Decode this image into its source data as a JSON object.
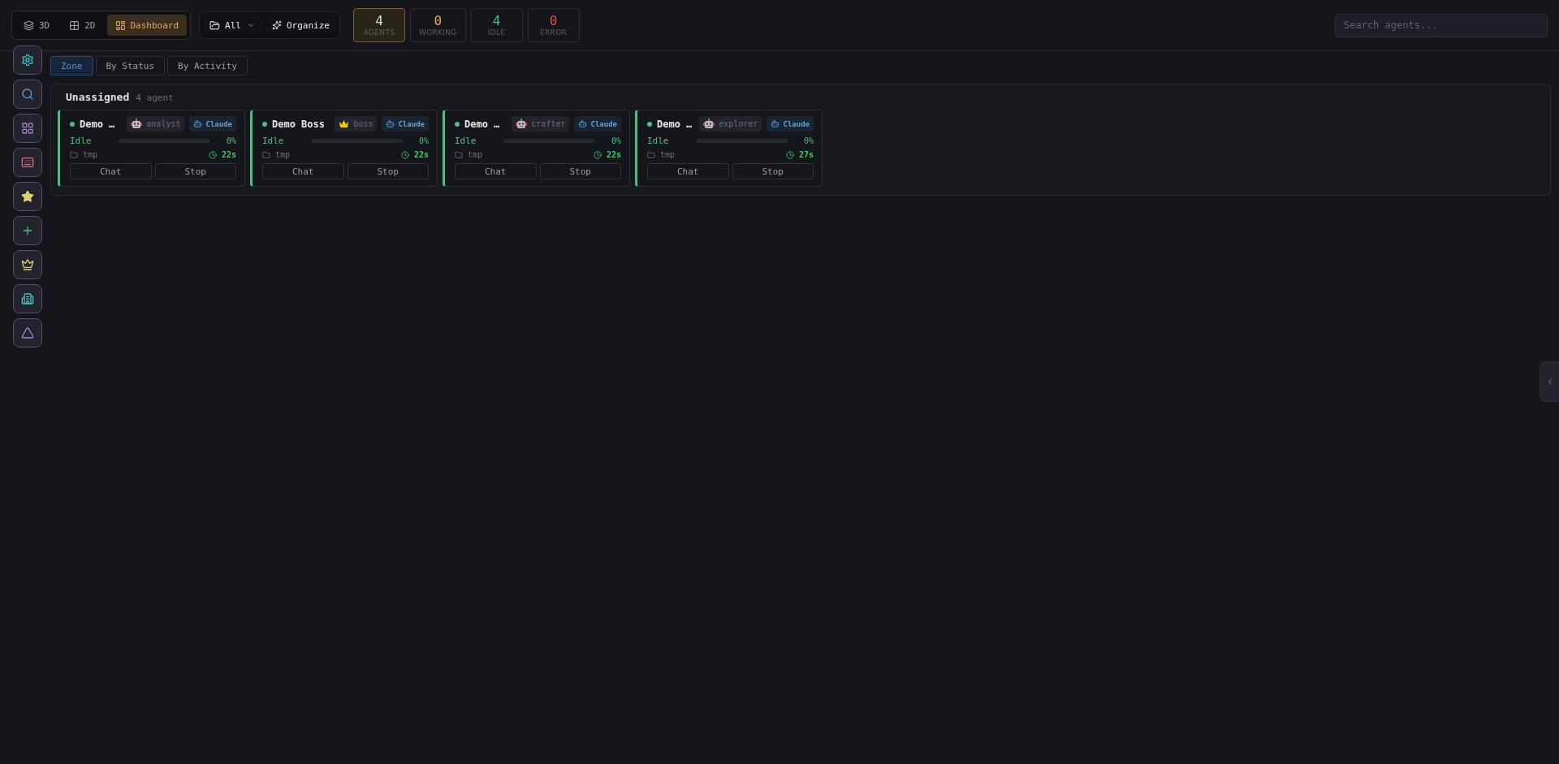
{
  "view_modes": [
    {
      "label": "3D",
      "kind": "layers",
      "selected": false
    },
    {
      "label": "2D",
      "kind": "grid",
      "selected": false
    },
    {
      "label": "Dashboard",
      "kind": "dashboard",
      "selected": true
    }
  ],
  "project_filter": {
    "label": "All"
  },
  "organize_button": {
    "label": "Organize"
  },
  "stats": [
    {
      "kind": "total",
      "value": "4",
      "label": "AGENTS",
      "selected": true
    },
    {
      "kind": "working",
      "value": "0",
      "label": "WORKING",
      "selected": false
    },
    {
      "kind": "idle",
      "value": "4",
      "label": "IDLE",
      "selected": false
    },
    {
      "kind": "error",
      "value": "0",
      "label": "ERROR",
      "selected": false
    }
  ],
  "search": {
    "placeholder": "Search agents..."
  },
  "group_tabs": [
    {
      "label": "Zone",
      "selected": true
    },
    {
      "label": "By Status",
      "selected": false
    },
    {
      "label": "By Activity",
      "selected": false
    }
  ],
  "sidebar": {
    "items": [
      {
        "kind": "settings"
      },
      {
        "kind": "search"
      },
      {
        "kind": "apps"
      },
      {
        "kind": "keyboard"
      },
      {
        "kind": "star"
      },
      {
        "kind": "add"
      },
      {
        "kind": "crown"
      },
      {
        "kind": "building"
      },
      {
        "kind": "triangle"
      }
    ]
  },
  "groups": [
    {
      "name": "Unassigned",
      "count": "4 agent",
      "agents": [
        {
          "name": "Demo …",
          "status": "Idle",
          "color": "#4fbf7f",
          "role": "analyst",
          "kind": "robot",
          "provider": "Claude",
          "level": 0,
          "percent": "0%",
          "folder": "tmp",
          "time": "22s",
          "actions": [
            "Chat",
            "Stop"
          ]
        },
        {
          "name": "Demo Boss",
          "status": "Idle",
          "color": "#4fbf7f",
          "role": "boss",
          "kind": "crown",
          "provider": "Claude",
          "level": 0,
          "percent": "0%",
          "folder": "tmp",
          "time": "22s",
          "actions": [
            "Chat",
            "Stop"
          ]
        },
        {
          "name": "Demo …",
          "status": "Idle",
          "color": "#4fbf7f",
          "role": "crafter",
          "kind": "robot",
          "provider": "Claude",
          "level": 0,
          "percent": "0%",
          "folder": "tmp",
          "time": "22s",
          "actions": [
            "Chat",
            "Stop"
          ]
        },
        {
          "name": "Demo …",
          "status": "Idle",
          "color": "#4fbf7f",
          "role": "explorer",
          "kind": "robot",
          "provider": "Claude",
          "level": 0,
          "percent": "0%",
          "folder": "tmp",
          "time": "27s",
          "actions": [
            "Chat",
            "Stop"
          ]
        }
      ]
    }
  ],
  "side_panel_toggle": {
    "expanded": false
  }
}
